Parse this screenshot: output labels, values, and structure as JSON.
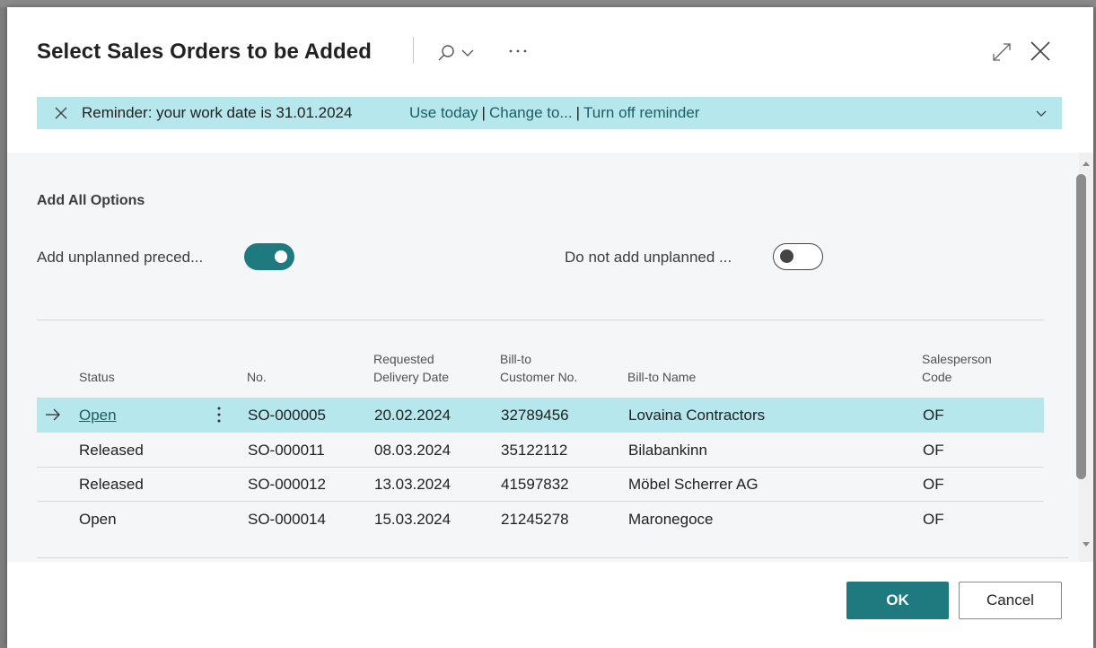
{
  "dialog": {
    "title": "Select Sales Orders to be Added",
    "more_label": "···"
  },
  "banner": {
    "text": "Reminder: your work date is 31.01.2024",
    "use_today": "Use today",
    "change_to": "Change to...",
    "turn_off": "Turn off reminder",
    "separator": "|"
  },
  "options": {
    "group_title": "Add All Options",
    "add_unplanned_label": "Add unplanned preced...",
    "add_unplanned_value": true,
    "do_not_add_label": "Do not add unplanned ...",
    "do_not_add_value": false
  },
  "table": {
    "headers": {
      "status": "Status",
      "no": "No.",
      "requested_1": "Requested",
      "requested_2": "Delivery Date",
      "billto_no_1": "Bill-to",
      "billto_no_2": "Customer No.",
      "billto_name": "Bill-to Name",
      "salesperson_1": "Salesperson",
      "salesperson_2": "Code"
    },
    "rows": [
      {
        "status": "Open",
        "no": "SO-000005",
        "date": "20.02.2024",
        "customer_no": "32789456",
        "name": "Lovaina Contractors",
        "salesperson": "OF"
      },
      {
        "status": "Released",
        "no": "SO-000011",
        "date": "08.03.2024",
        "customer_no": "35122112",
        "name": "Bilabankinn",
        "salesperson": "OF"
      },
      {
        "status": "Released",
        "no": "SO-000012",
        "date": "13.03.2024",
        "customer_no": "41597832",
        "name": "Möbel Scherrer AG",
        "salesperson": "OF"
      },
      {
        "status": "Open",
        "no": "SO-000014",
        "date": "15.03.2024",
        "customer_no": "21245278",
        "name": "Maronegoce",
        "salesperson": "OF"
      }
    ]
  },
  "buttons": {
    "ok": "OK",
    "cancel": "Cancel"
  },
  "colors": {
    "accent": "#1f7a80",
    "banner": "#b6e7ec",
    "link": "#1c5e66"
  }
}
